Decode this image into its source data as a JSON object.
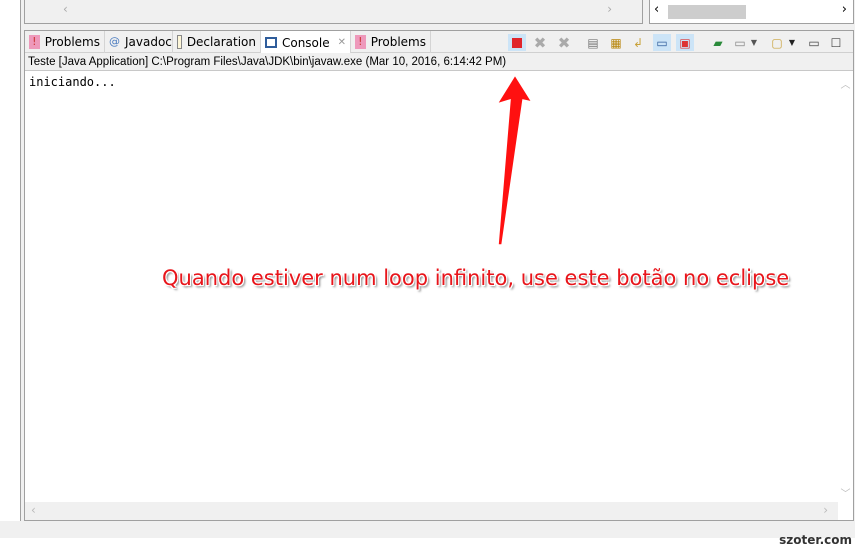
{
  "tabs": [
    {
      "label": "Problems",
      "icon": "problems-icon"
    },
    {
      "label": "Javadoc",
      "icon": "at-icon"
    },
    {
      "label": "Declaration",
      "icon": "declaration-icon"
    },
    {
      "label": "Console",
      "icon": "console-icon",
      "active": true
    },
    {
      "label": "Problems",
      "icon": "problems-icon"
    }
  ],
  "console": {
    "description": "Teste [Java Application] C:\\Program Files\\Java\\JDK\\bin\\javaw.exe (Mar 10, 2016, 6:14:42 PM)",
    "output": "iniciando..."
  },
  "toolbar": [
    "terminate",
    "remove-launch",
    "remove-all-terminated",
    "clear-console",
    "scroll-lock",
    "word-wrap",
    "show-on-stdout",
    "show-on-stderr",
    "pin-console",
    "display-selected-console",
    "open-console",
    "minimize",
    "maximize"
  ],
  "annotation": {
    "text": "Quando estiver num loop infinito, use este botão no eclipse",
    "color": "#e8151b"
  },
  "watermark": "szoter.com",
  "colors": {
    "terminate": "#e0252b",
    "arrow": "#ff1010"
  }
}
